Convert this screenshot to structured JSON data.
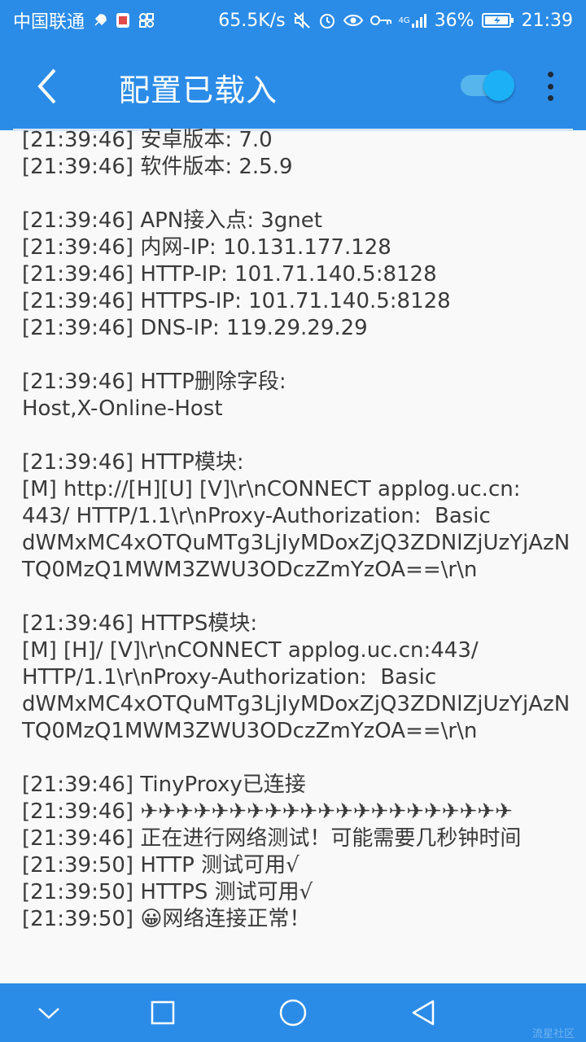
{
  "status_bar": {
    "carrier": "中国联通",
    "speed": "65.5K/s",
    "network": "4G",
    "battery": "36%",
    "time": "21:39",
    "icons": [
      "rocket-icon",
      "notification-app-icon",
      "app-shortcut-icon",
      "mute-icon",
      "alarm-icon",
      "eye-icon",
      "key-icon",
      "signal-icon",
      "battery-charging-icon"
    ]
  },
  "app_bar": {
    "title": "配置已载入",
    "toggle_on": true,
    "accent_color": "#2b8ce8",
    "toggle_color": "#1cb0f6"
  },
  "log": {
    "lines": [
      "[21:39:46] 安卓版本: 7.0",
      "[21:39:46] 软件版本: 2.5.9",
      "",
      "[21:39:46] APN接入点: 3gnet",
      "[21:39:46] 内网-IP: 10.131.177.128",
      "[21:39:46] HTTP-IP: 101.71.140.5:8128",
      "[21:39:46] HTTPS-IP: 101.71.140.5:8128",
      "[21:39:46] DNS-IP: 119.29.29.29",
      "",
      "[21:39:46] HTTP删除字段:",
      "Host,X-Online-Host",
      "",
      "[21:39:46] HTTP模块:",
      "[M] http://[H][U] [V]\\r\\nCONNECT applog.uc.cn:",
      "443/ HTTP/1.1\\r\\nProxy-Authorization:  Basic",
      "dWMxMC4xOTQuMTg3LjIyMDoxZjQ3ZDNlZjUzYjAzN",
      "TQ0MzQ1MWM3ZWU3ODczZmYzOA==\\r\\n",
      "",
      "[21:39:46] HTTPS模块:",
      "[M] [H]/ [V]\\r\\nCONNECT applog.uc.cn:443/",
      "HTTP/1.1\\r\\nProxy-Authorization:  Basic",
      "dWMxMC4xOTQuMTg3LjIyMDoxZjQ3ZDNlZjUzYjAzN",
      "TQ0MzQ1MWM3ZWU3ODczZmYzOA==\\r\\n",
      "",
      "[21:39:46] TinyProxy已连接",
      "[21:39:46] ✈✈✈✈✈✈✈✈✈✈✈✈✈✈✈✈✈✈✈✈✈",
      "[21:39:46] 正在进行网络测试！可能需要几秒钟时间",
      "[21:39:50] HTTP 测试可用√",
      "[21:39:50] HTTPS 测试可用√",
      "[21:39:50] 😀网络连接正常！"
    ]
  },
  "nav_bar": {
    "buttons": [
      "chevron-down-icon",
      "square-icon",
      "circle-icon",
      "triangle-back-icon"
    ]
  },
  "watermark": "流星社区"
}
